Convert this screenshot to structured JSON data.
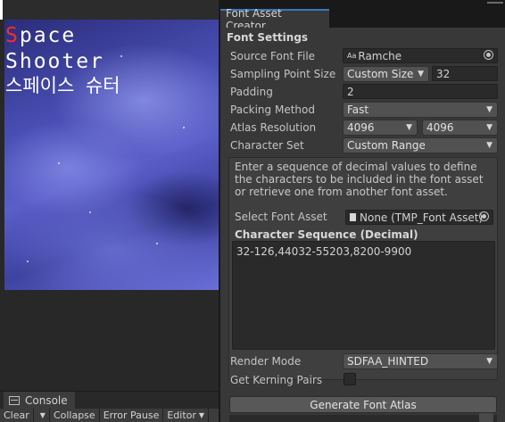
{
  "scene": {
    "title_line1_first": "S",
    "title_line1_rest": "pace",
    "title_line2": "Shooter",
    "title_line3": "스페이스 슈터"
  },
  "console": {
    "tab_label": "Console",
    "toolbar": {
      "clear": "Clear",
      "collapse": "Collapse",
      "error_pause": "Error Pause",
      "editor": "Editor"
    }
  },
  "font_asset_creator": {
    "tab_label": "Font Asset Creator",
    "section_title": "Font Settings",
    "source_font_file": {
      "label": "Source Font File",
      "value": "Ramche",
      "icon": "font-asset-icon"
    },
    "sampling_point_size": {
      "label": "Sampling Point Size",
      "mode": "Custom Size",
      "value": "32"
    },
    "padding": {
      "label": "Padding",
      "value": "2"
    },
    "packing_method": {
      "label": "Packing Method",
      "value": "Fast"
    },
    "atlas_resolution": {
      "label": "Atlas Resolution",
      "width": "4096",
      "height": "4096"
    },
    "character_set": {
      "label": "Character Set",
      "value": "Custom Range"
    },
    "help_text": "Enter a sequence of decimal values to define the characters to be included in the font asset or retrieve one from another font asset.",
    "select_font_asset": {
      "label": "Select Font Asset",
      "value": "None (TMP_Font Asset)"
    },
    "character_sequence": {
      "label": "Character Sequence (Decimal)",
      "value": "32-126,44032-55203,8200-9900"
    },
    "render_mode": {
      "label": "Render Mode",
      "value": "SDFAA_HINTED"
    },
    "get_kerning_pairs": {
      "label": "Get Kerning Pairs",
      "checked": false
    },
    "generate_button": "Generate Font Atlas"
  },
  "colors": {
    "panel_bg": "#383838",
    "field_bg": "#2a2a2a",
    "accent_tab": "#3a79bb",
    "title_red": "#ff2a2a"
  }
}
